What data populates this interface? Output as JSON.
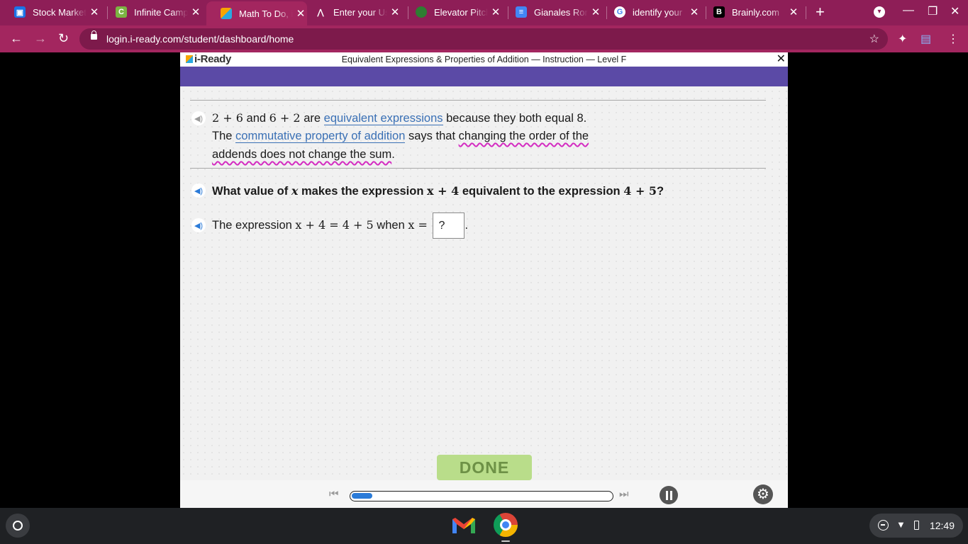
{
  "browser": {
    "tabs": [
      {
        "title": "Stock Market",
        "icon": "classroom-icon",
        "color": "#1a73e8"
      },
      {
        "title": "Infinite Campus",
        "icon": "campus-icon",
        "color": "#7cb342"
      },
      {
        "title": "Math To Do, i-Ready",
        "icon": "iready-cube-icon",
        "color": "#f7a400",
        "active": true
      },
      {
        "title": "Enter your Username",
        "icon": "clever-icon",
        "color": "#1d4ed8"
      },
      {
        "title": "Elevator Pitch",
        "icon": "globe-icon",
        "color": "#2e7d32"
      },
      {
        "title": "Gianales Ron",
        "icon": "docs-icon",
        "color": "#4285f4"
      },
      {
        "title": "identify your",
        "icon": "google-icon",
        "color": "#ffffff"
      },
      {
        "title": "Brainly.com",
        "icon": "brainly-icon",
        "color": "#000000"
      }
    ],
    "url": "login.i-ready.com/student/dashboard/home"
  },
  "lesson": {
    "logo": "i-Ready",
    "title": "Equivalent Expressions & Properties of Addition — Instruction — Level F",
    "close": "✕",
    "para1": {
      "expr_a": "2 + 6",
      "and": "and",
      "expr_b": "6 + 2",
      "are": "are",
      "term1": "equivalent expressions",
      "rest": "because they both equal 8."
    },
    "para2": {
      "the": "The",
      "term2": "commutative property of addition",
      "says": "says that",
      "emph_a": "changing the order of the",
      "emph_b": "addends does not change the sum",
      "period": "."
    },
    "question": {
      "prefix": "What value of",
      "var": "x",
      "mid": "makes the expression",
      "expr1": "x + 4",
      "mid2": "equivalent to the expression",
      "expr2": "4 + 5",
      "suffix": "?"
    },
    "answer_line": {
      "prefix": "The expression",
      "equation": "x + 4 = 4 + 5",
      "when": "when",
      "var_eq": "x =",
      "input_value": "?",
      "period": "."
    },
    "done_label": "DONE",
    "progress": 0.08
  },
  "shelf": {
    "clock": "12:49"
  }
}
